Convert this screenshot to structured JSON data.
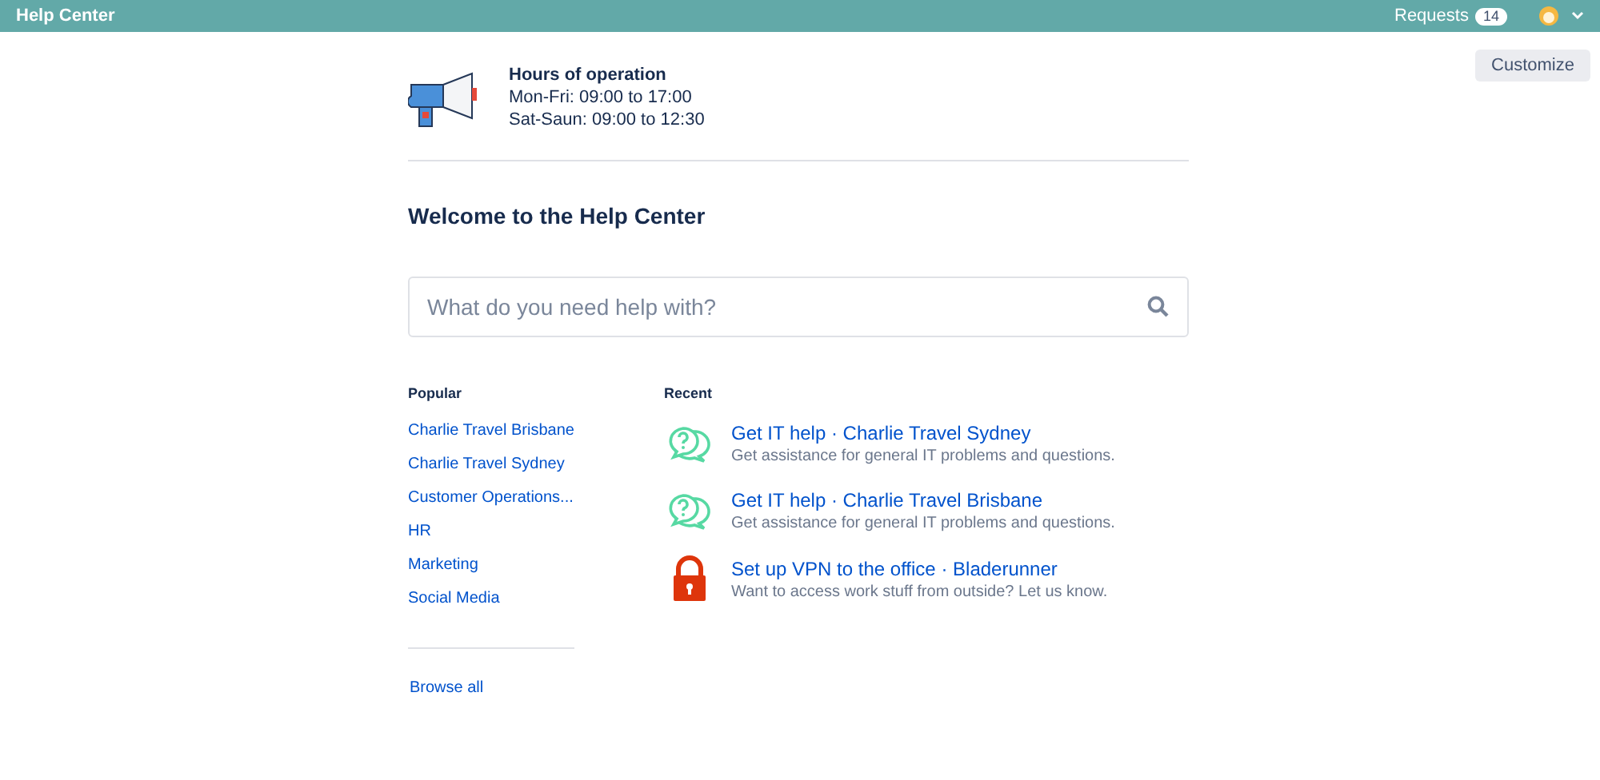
{
  "header": {
    "title": "Help Center",
    "requests_label": "Requests",
    "requests_count": "14"
  },
  "customize_button": "Customize",
  "hours": {
    "title": "Hours of operation",
    "lines": [
      "Mon-Fri: 09:00 to 17:00",
      "Sat-Saun: 09:00 to 12:30"
    ]
  },
  "welcome": "Welcome to the Help Center",
  "search": {
    "placeholder": "What do you need help with?"
  },
  "popular": {
    "heading": "Popular",
    "items": [
      "Charlie Travel Brisbane",
      "Charlie Travel Sydney",
      "Customer Operations...",
      "HR",
      "Marketing",
      "Social Media"
    ],
    "browse_all": "Browse all"
  },
  "recent": {
    "heading": "Recent",
    "items": [
      {
        "kind": "chat",
        "title": "Get IT help · Charlie Travel Sydney",
        "description": "Get assistance for general IT problems and questions."
      },
      {
        "kind": "chat",
        "title": "Get IT help · Charlie Travel Brisbane",
        "description": "Get assistance for general IT problems and questions."
      },
      {
        "kind": "lock",
        "title": "Set up VPN to the office · Bladerunner",
        "description": "Want to access work stuff from outside? Let us know."
      }
    ]
  }
}
